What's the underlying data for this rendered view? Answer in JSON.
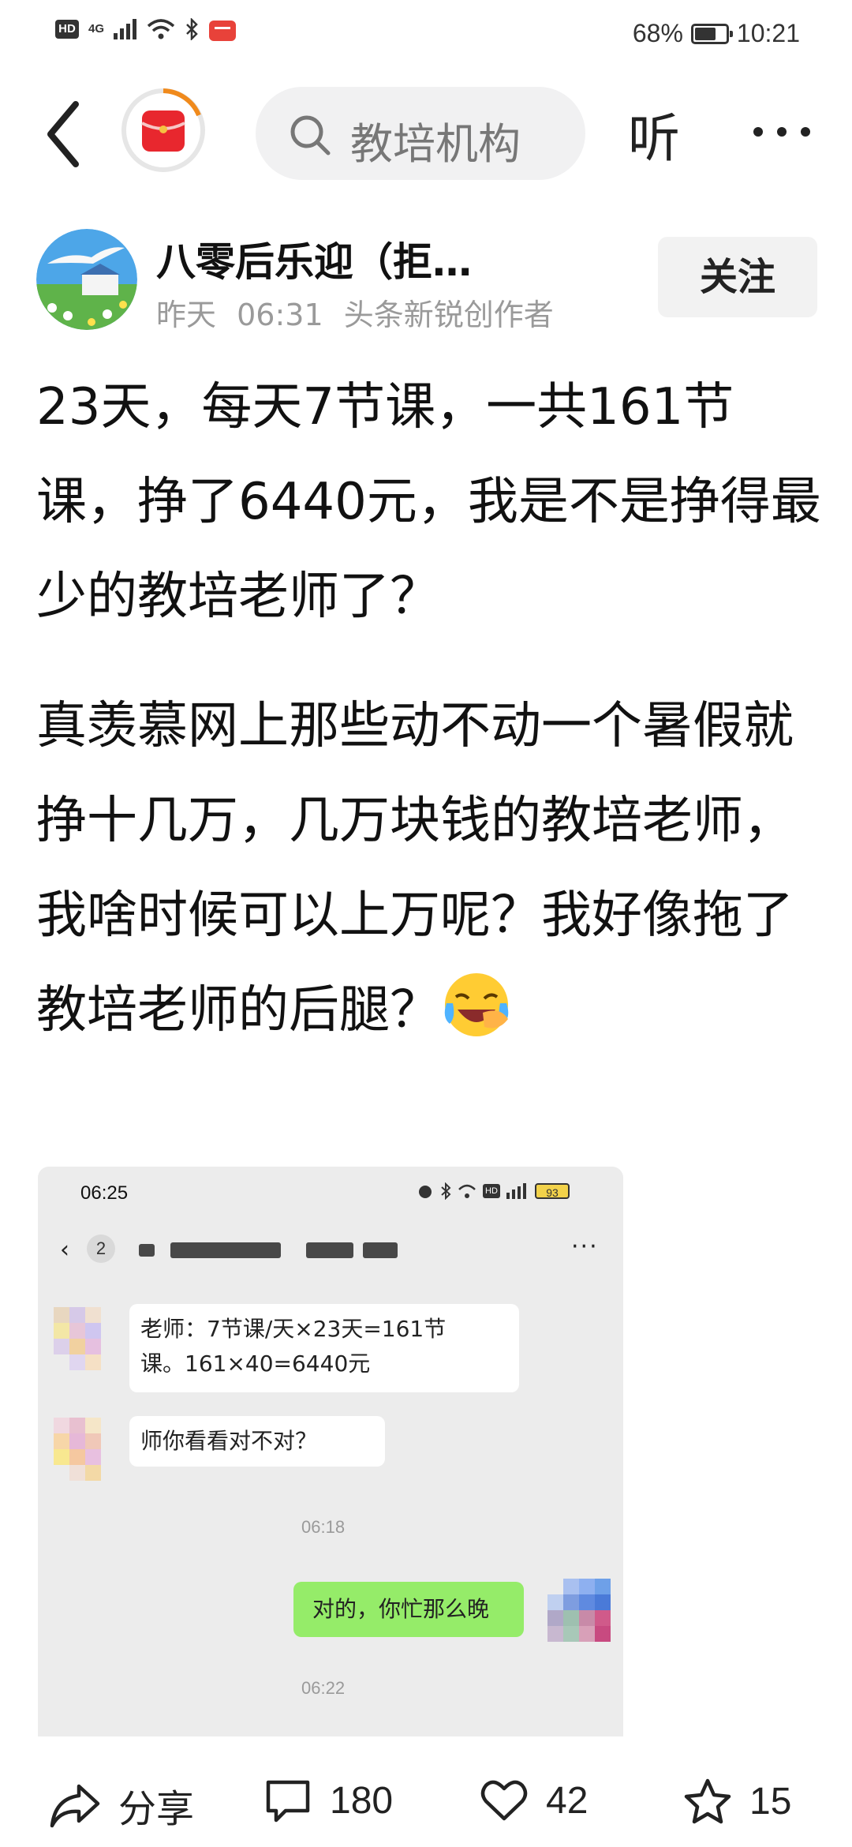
{
  "status_bar": {
    "hd": "HD",
    "network": "4G",
    "battery_percent": "68%",
    "battery_level": 0.68,
    "time": "10:21"
  },
  "top_nav": {
    "search_placeholder": "教培机构",
    "listen_label": "听",
    "more_label": "···"
  },
  "author": {
    "name": "八零后乐迎（拒…",
    "date": "昨天",
    "time": "06:31",
    "title": "头条新锐创作者",
    "follow_label": "关注"
  },
  "article": {
    "paragraph_1": "23天，每天7节课，一共161节课，挣了6440元，我是不是挣得最少的教培老师了？",
    "paragraph_2": "真羡慕网上那些动不动一个暑假就挣十几万，几万块钱的教培老师，我啥时候可以上万呢？我好像拖了教培老师的后腿？"
  },
  "chat_screenshot": {
    "time": "06:25",
    "battery": "93",
    "unread_count": "2",
    "messages": [
      {
        "from": "other",
        "text_line_1": "老师：7节课/天×23天=161节",
        "text_line_2": "课。161×40=6440元"
      },
      {
        "from": "other",
        "text": "师你看看对不对？"
      },
      {
        "timestamp": "06:18"
      },
      {
        "from": "me",
        "text": "对的，你忙那么晚"
      },
      {
        "timestamp": "06:22"
      }
    ]
  },
  "bottom_bar": {
    "share_label": "分享",
    "comments": "180",
    "likes": "42",
    "favorites": "15"
  },
  "colors": {
    "accent_orange": "#f08a1c",
    "badge_red": "#e8272e",
    "chat_green": "#95ec69"
  }
}
